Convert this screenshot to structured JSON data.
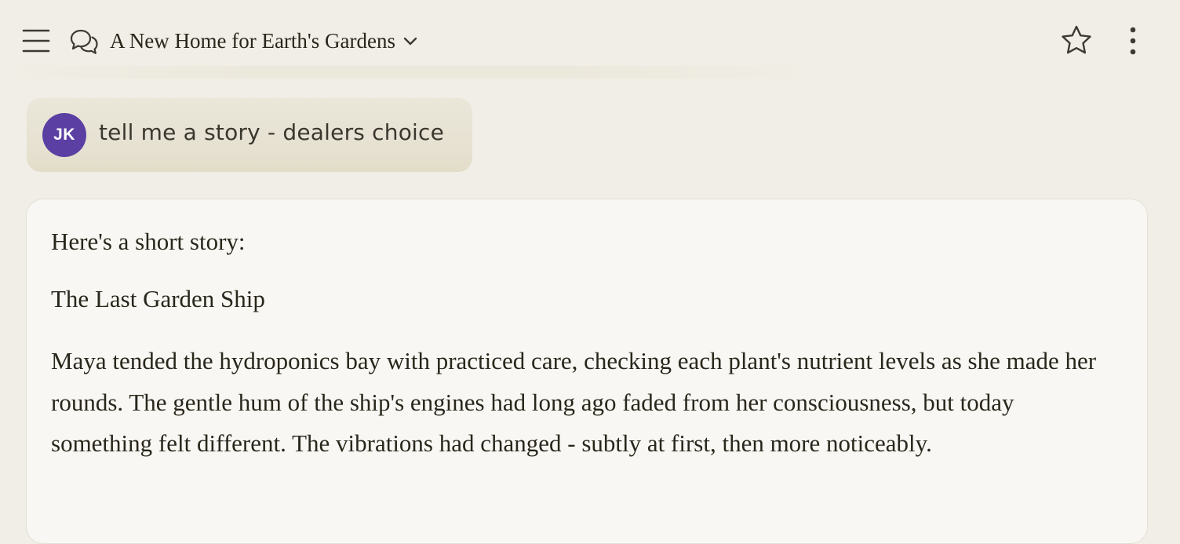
{
  "header": {
    "title": "A New Home for Earth's Gardens",
    "icons": {
      "menu": "hamburger-menu-icon",
      "chat": "chat-bubbles-icon",
      "title_dropdown": "chevron-down-icon",
      "favorite": "star-outline-icon",
      "more": "vertical-ellipsis-icon"
    }
  },
  "conversation": {
    "user_message": {
      "avatar_initials": "JK",
      "avatar_color": "#5b3fa3",
      "text": "tell me a story - dealers choice"
    },
    "assistant_message": {
      "intro": "Here's a short story:",
      "story_title": "The Last Garden Ship",
      "paragraph_1": "Maya tended the hydroponics bay with practiced care, checking each plant's nutrient levels as she made her rounds. The gentle hum of the ship's engines had long ago faded from her consciousness, but today something felt different. The vibrations had changed - subtly at first, then more noticeably."
    }
  },
  "colors": {
    "background": "#f0eee6",
    "card_background": "#f8f7f3",
    "text": "#29261b"
  }
}
